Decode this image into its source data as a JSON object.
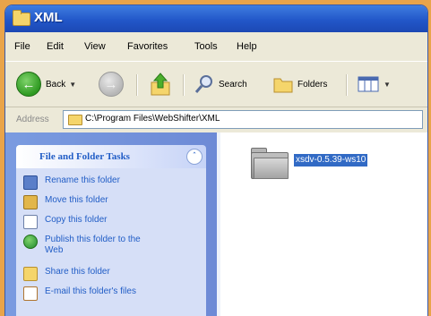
{
  "window": {
    "title": "XML"
  },
  "menu": {
    "items": [
      "File",
      "Edit",
      "View",
      "Favorites",
      "Tools",
      "Help"
    ]
  },
  "toolbar": {
    "back_label": "Back",
    "search_label": "Search",
    "folders_label": "Folders",
    "icons": {
      "back": "back-arrow-icon",
      "forward": "forward-arrow-icon",
      "up": "up-folder-icon",
      "search": "search-icon",
      "folders": "folders-icon",
      "views": "views-icon"
    }
  },
  "address": {
    "label": "Address",
    "value": "C:\\Program Files\\WebShifter\\XML"
  },
  "tasks": {
    "title": "File and Folder Tasks",
    "items": [
      {
        "label": "Rename this folder",
        "icon": "rename-icon"
      },
      {
        "label": "Move this folder",
        "icon": "move-icon"
      },
      {
        "label": "Copy this folder",
        "icon": "copy-icon"
      },
      {
        "label": "Publish this folder to the Web",
        "icon": "publish-icon"
      },
      {
        "label": "Share this folder",
        "icon": "share-icon"
      },
      {
        "label": "E-mail this folder's files",
        "icon": "email-icon"
      }
    ]
  },
  "files": {
    "items": [
      {
        "name": "xsdv-0.5.39-ws10",
        "selected": true,
        "icon": "folder-icon"
      }
    ]
  },
  "colors": {
    "titlebar": "#2257c9",
    "selection": "#316ac5",
    "task_link": "#215dc6",
    "taskpane": "#6d8ad6"
  }
}
